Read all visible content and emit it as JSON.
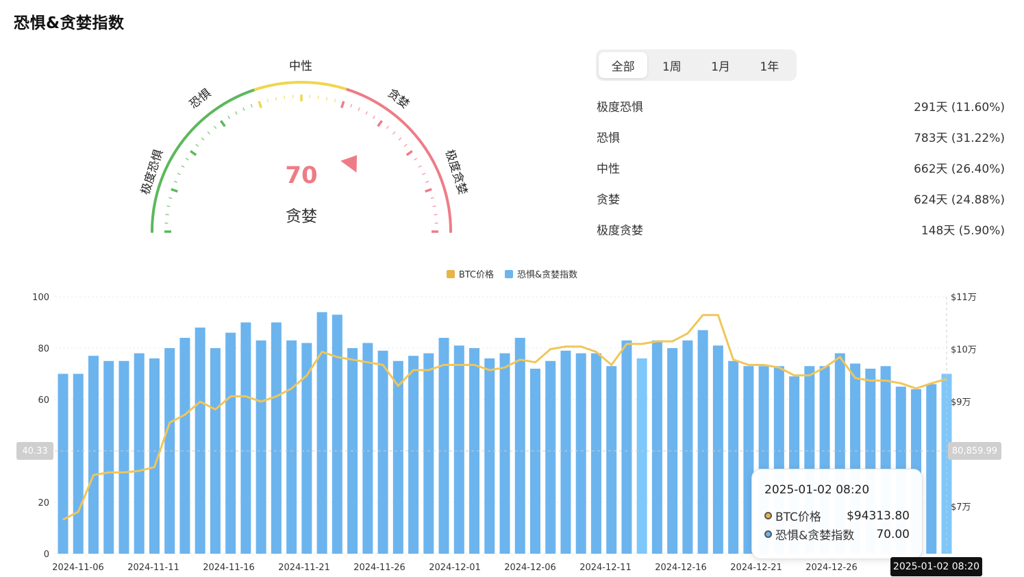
{
  "page_title": "恐惧&贪婪指数",
  "gauge": {
    "value": "70",
    "value_number": 70,
    "status": "贪婪",
    "zone_labels": {
      "extreme_fear": "极度恐惧",
      "fear": "恐惧",
      "neutral": "中性",
      "greed": "贪婪",
      "extreme_greed": "极度贪婪"
    },
    "colors": {
      "fear": "#5cb85c",
      "neutral": "#f0d64e",
      "greed": "#ee7c86",
      "value": "#ee7c86"
    }
  },
  "range_tabs": [
    {
      "label": "全部",
      "active": true
    },
    {
      "label": "1周",
      "active": false
    },
    {
      "label": "1月",
      "active": false
    },
    {
      "label": "1年",
      "active": false
    }
  ],
  "stats": [
    {
      "label": "极度恐惧",
      "value": "291天 (11.60%)"
    },
    {
      "label": "恐惧",
      "value": "783天 (31.22%)"
    },
    {
      "label": "中性",
      "value": "662天 (26.40%)"
    },
    {
      "label": "贪婪",
      "value": "624天 (24.88%)"
    },
    {
      "label": "极度贪婪",
      "value": "148天 (5.90%)"
    }
  ],
  "crosshair": {
    "left_value": "40.33",
    "right_value": "80,859.99"
  },
  "tooltip": {
    "time": "2025-01-02 08:20",
    "rows": [
      {
        "name": "BTC价格",
        "value": "$94313.80",
        "color": "#e8b44a"
      },
      {
        "name": "恐惧&贪婪指数",
        "value": "70.00",
        "color": "#6cb4ee"
      }
    ]
  },
  "hover_time_label": "2025-01-02 08:20",
  "chart_data": {
    "type": "bar",
    "legend": [
      {
        "name": "BTC价格",
        "color": "#e8b44a"
      },
      {
        "name": "恐惧&贪婪指数",
        "color": "#6cb4ee"
      }
    ],
    "x_tick_labels": [
      "2024-11-06",
      "2024-11-11",
      "2024-11-16",
      "2024-11-21",
      "2024-11-26",
      "2024-12-01",
      "2024-12-06",
      "2024-12-11",
      "2024-12-16",
      "2024-12-21",
      "2024-12-26",
      "20"
    ],
    "y_left_ticks": [
      "0",
      "20",
      "60",
      "80",
      "100"
    ],
    "y_left_tick_values": [
      0,
      20,
      60,
      80,
      100
    ],
    "y_left_range": [
      0,
      100
    ],
    "y_right_ticks": [
      {
        "label": "$7万",
        "value": 70000
      },
      {
        "label": "$9万",
        "value": 90000
      },
      {
        "label": "$10万",
        "value": 100000
      },
      {
        "label": "$11万",
        "value": 110000
      }
    ],
    "y_right_range": [
      61000,
      110000
    ],
    "grid": true,
    "series": [
      {
        "name": "恐惧&贪婪指数",
        "type": "bar",
        "color": "#6cb4ee",
        "values": [
          70,
          70,
          77,
          75,
          75,
          78,
          76,
          80,
          84,
          88,
          80,
          86,
          90,
          83,
          90,
          83,
          82,
          94,
          93,
          80,
          82,
          79,
          75,
          77,
          78,
          84,
          81,
          80,
          76,
          78,
          84,
          72,
          75,
          79,
          78,
          78,
          73,
          83,
          76,
          83,
          80,
          83,
          87,
          81,
          75,
          73,
          73,
          73,
          69,
          73,
          73,
          78,
          74,
          72,
          73,
          65,
          64,
          66,
          70
        ]
      },
      {
        "name": "BTC价格",
        "type": "line",
        "color": "#f0c65a",
        "values": [
          67500,
          69000,
          76000,
          76500,
          76500,
          76800,
          77500,
          86000,
          87500,
          90000,
          88500,
          91000,
          91000,
          90000,
          91000,
          92500,
          95000,
          99500,
          98500,
          98000,
          97500,
          97000,
          93000,
          96000,
          96000,
          97000,
          97000,
          97000,
          96000,
          96500,
          98000,
          97500,
          100000,
          100500,
          100500,
          99500,
          97000,
          101000,
          101000,
          101500,
          101500,
          103000,
          106500,
          106500,
          98000,
          97000,
          97000,
          96500,
          95000,
          95000,
          96500,
          98500,
          94500,
          94000,
          94000,
          93500,
          92500,
          93500,
          94313.8
        ]
      }
    ]
  }
}
